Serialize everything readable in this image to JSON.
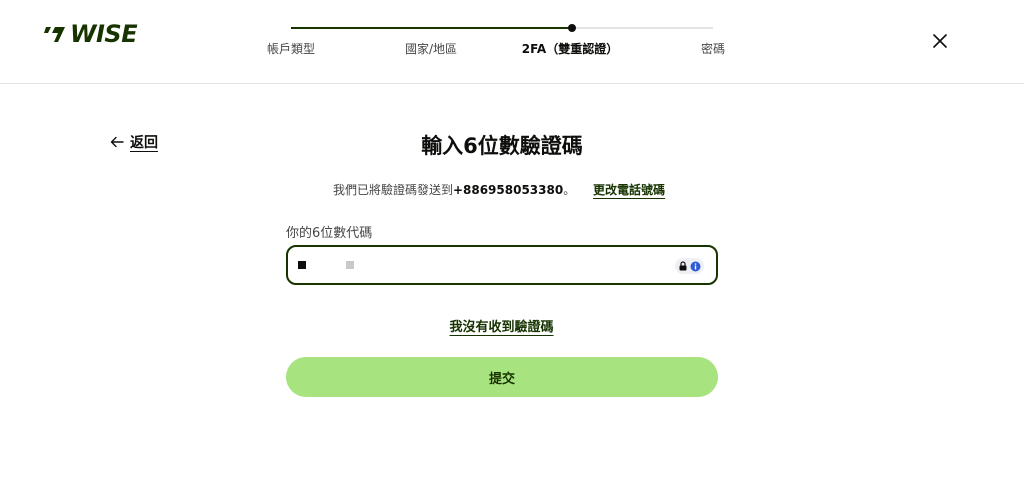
{
  "brand": {
    "name": "WISE",
    "color": "#163300",
    "icon": "wise-flag-icon"
  },
  "stepper": {
    "steps": [
      {
        "label": "帳戶類型"
      },
      {
        "label": "國家/地區"
      },
      {
        "label": "2FA（雙重認證）"
      },
      {
        "label": "密碼"
      }
    ],
    "current_step": 3,
    "progress": 0.667
  },
  "header": {
    "close_icon": "close-icon"
  },
  "back": {
    "label": "返回",
    "icon": "arrow-left-icon"
  },
  "main": {
    "title": "輸入6位數驗證碼",
    "subtitle_prefix": "我們已將驗證碼發送到",
    "phone": "+886958053380",
    "subtitle_suffix": "。",
    "change_phone_label": "更改電話號碼",
    "field_label": "你的6位數代碼",
    "input_value": "",
    "password_manager_icon": "lock-info-icon",
    "no_code_label": "我沒有收到驗證碼",
    "submit_label": "提交"
  },
  "colors": {
    "accent": "#163300",
    "button": "#a7e37e",
    "track": "#e3e4e1"
  }
}
